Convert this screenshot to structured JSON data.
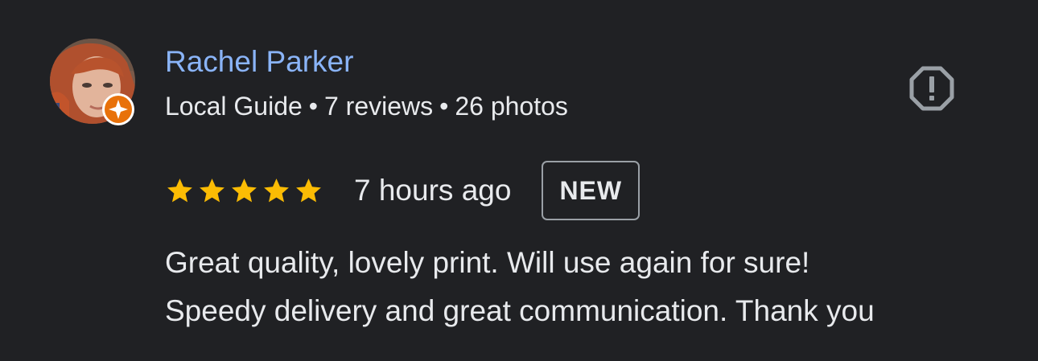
{
  "review": {
    "author": {
      "name": "Rachel Parker",
      "avatar_icon": "user-avatar-photo",
      "badge_icon": "local-guide-star-icon",
      "badge_color": "#e8710a"
    },
    "meta": {
      "guide_label": "Local Guide",
      "separator": "•",
      "reviews": "7 reviews",
      "photos": "26 photos"
    },
    "report_icon": "report-octagon-exclamation-icon",
    "rating": {
      "stars": 5,
      "max": 5,
      "star_icon": "star-icon",
      "star_color": "#fbbc04"
    },
    "time_ago": "7 hours ago",
    "badge_new": "NEW",
    "text": {
      "line1": "Great quality, lovely print. Will use again for sure!",
      "line2": "Speedy delivery and great communication. Thank you"
    },
    "colors": {
      "background": "#202124",
      "author_link": "#8ab4f8",
      "text": "#e8eaed",
      "icon_gray": "#9aa0a6"
    }
  }
}
